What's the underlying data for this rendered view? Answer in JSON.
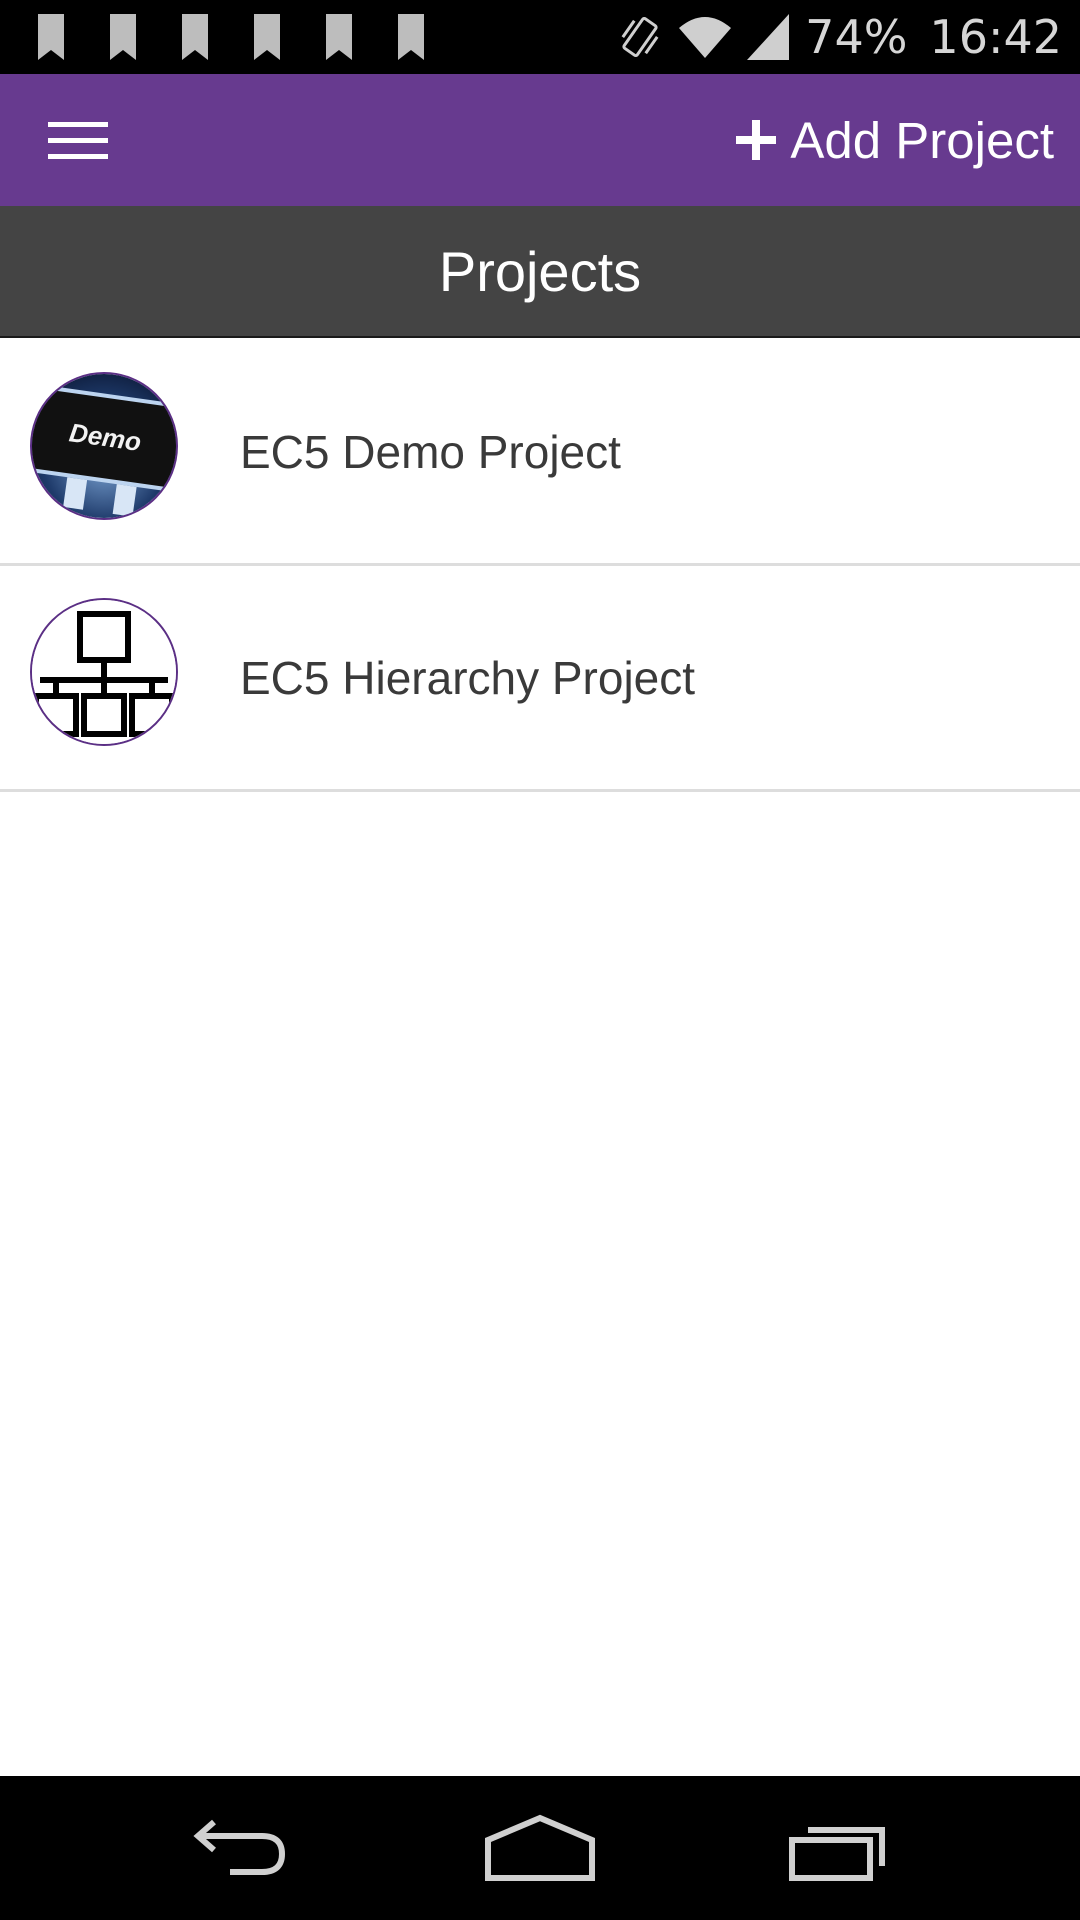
{
  "status_bar": {
    "notification_icons": [
      "bookmark-icon",
      "bookmark-icon",
      "bookmark-icon",
      "bookmark-icon",
      "bookmark-icon",
      "bookmark-icon"
    ],
    "battery": "74%",
    "time": "16:42",
    "icon_color": "#bdbdbd"
  },
  "app_bar": {
    "color": "#673a8f",
    "menu_icon": "hamburger-menu-icon",
    "add_project_label": "Add Project"
  },
  "title_bar": {
    "title": "Projects",
    "color": "#444444"
  },
  "projects": [
    {
      "name": "EC5 Demo Project",
      "avatar_text": "Demo"
    },
    {
      "name": "EC5 Hierarchy Project",
      "avatar_icon": "hierarchy-icon"
    }
  ],
  "nav_bar": {
    "buttons": [
      "back-icon",
      "home-icon",
      "recents-icon"
    ]
  }
}
